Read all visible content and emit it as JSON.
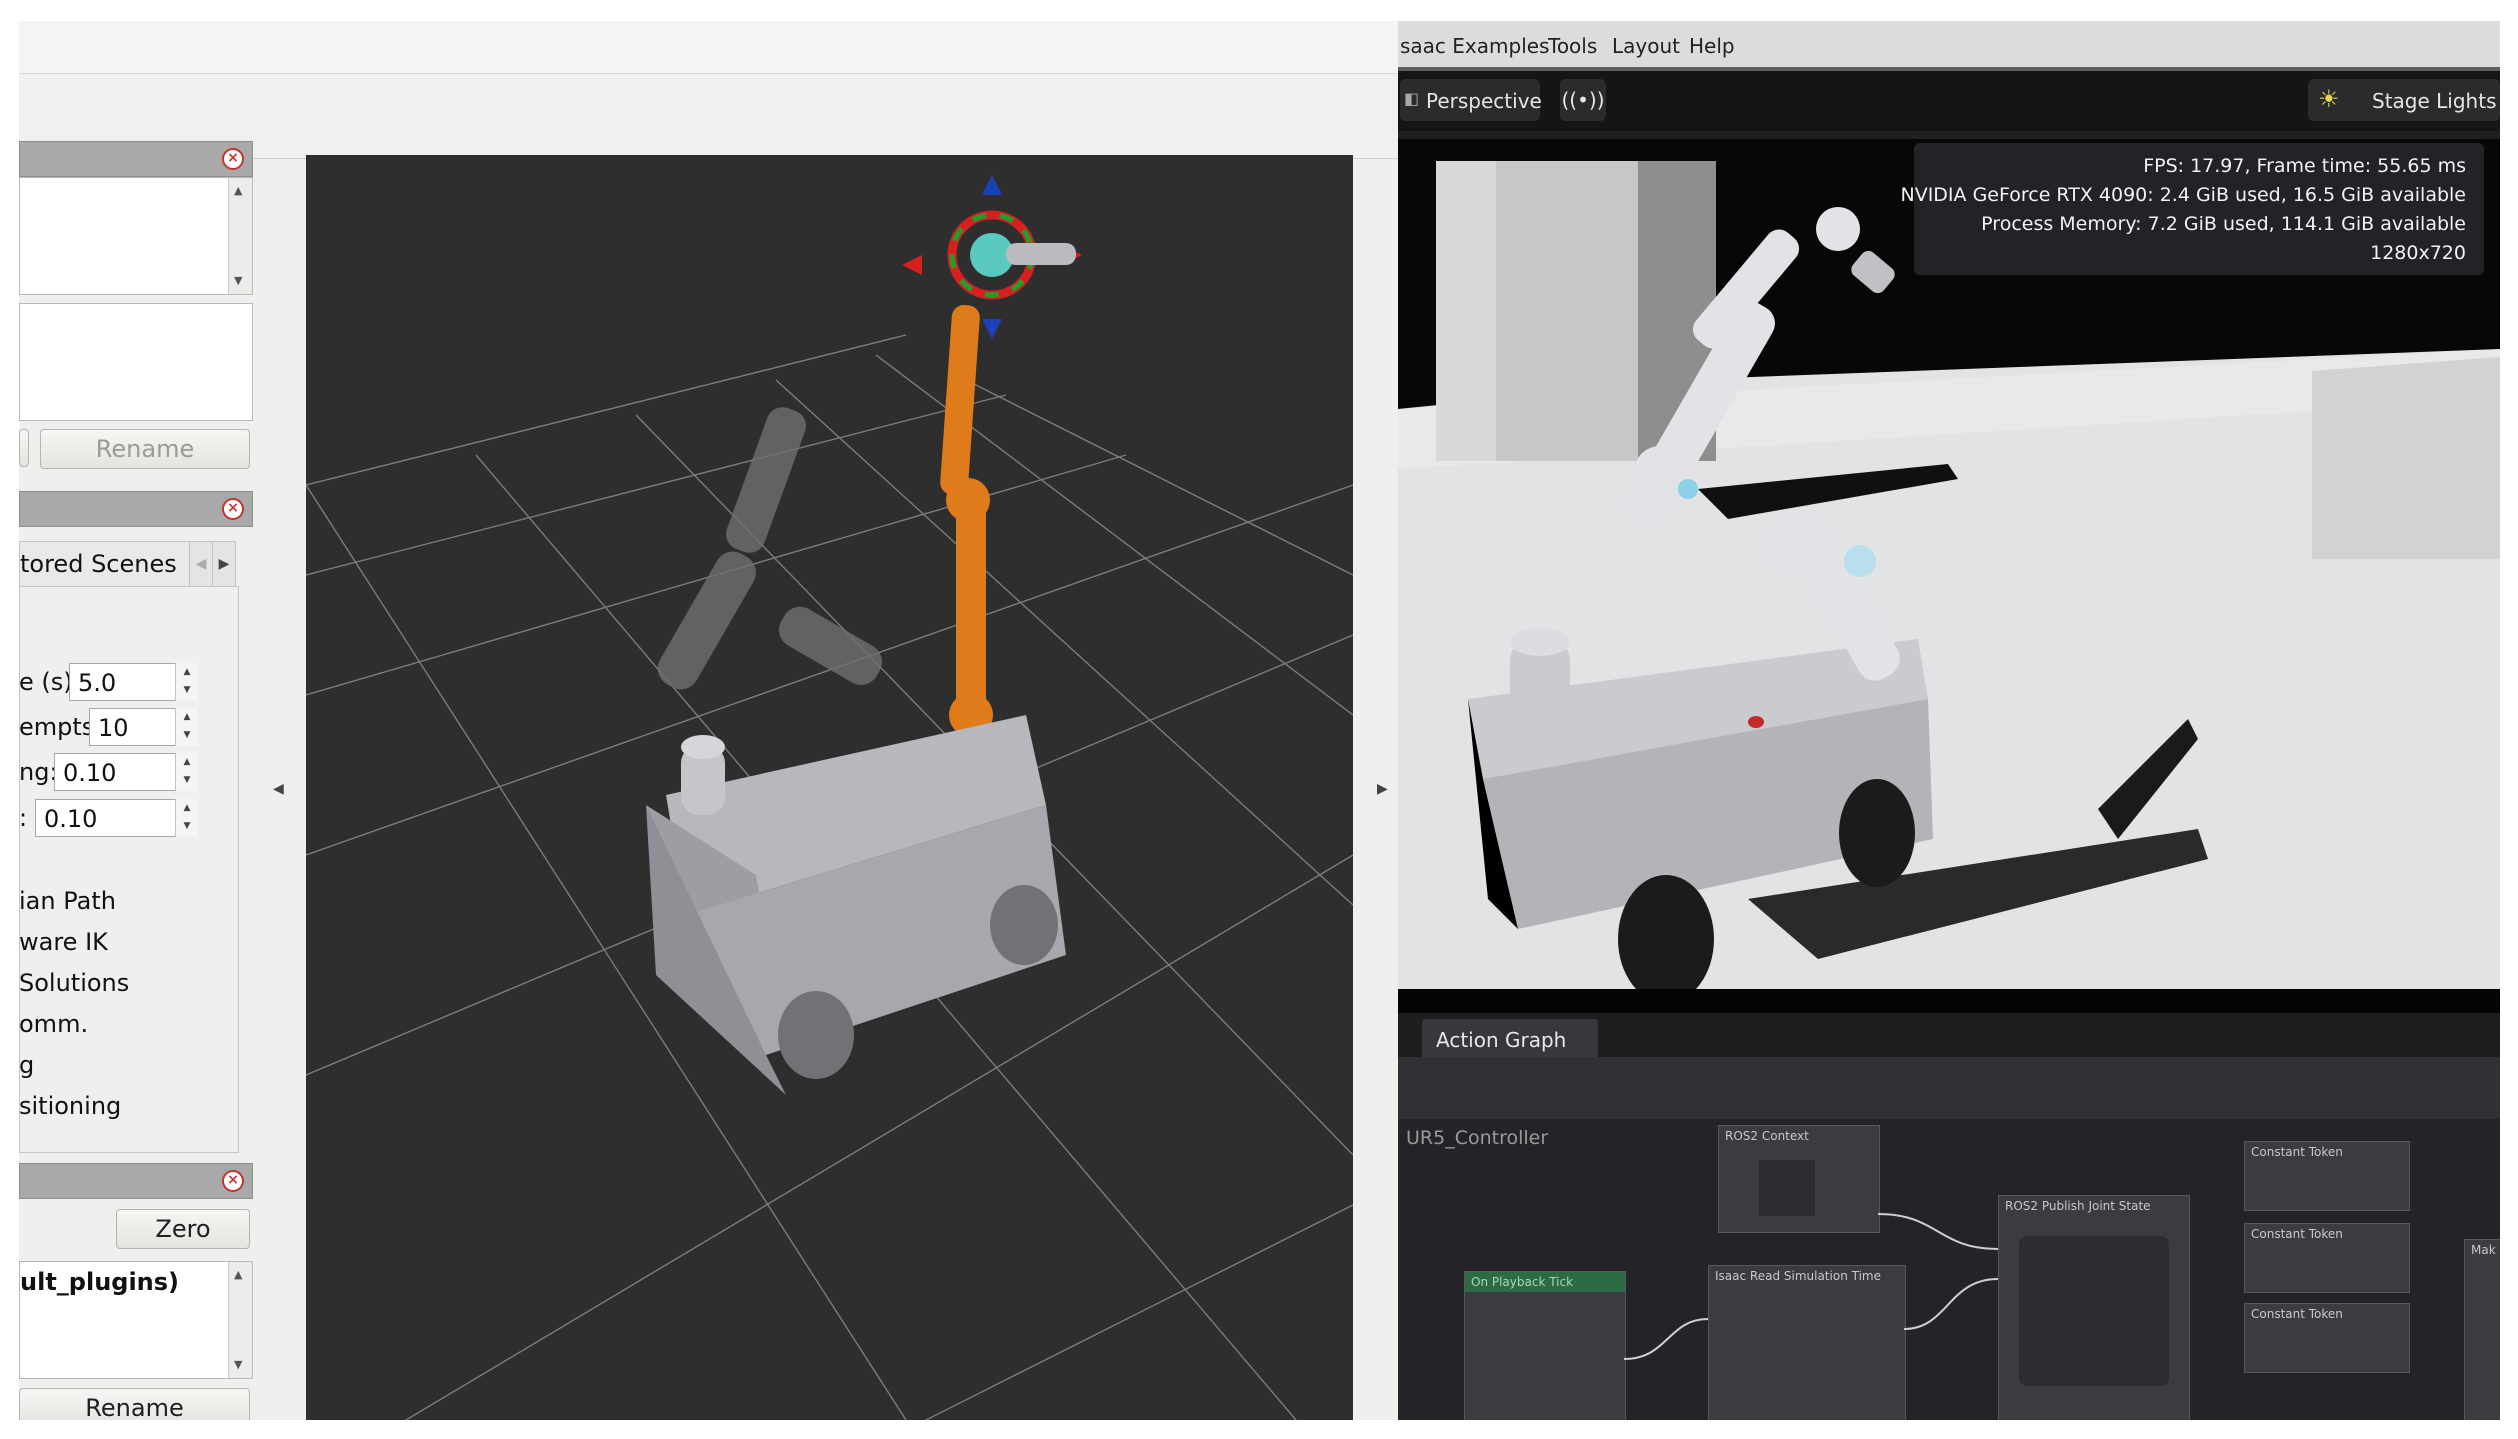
{
  "rviz": {
    "panels": {
      "scenes_panel": {
        "rename_label": "Rename"
      },
      "tabs": {
        "stored_scenes_label": "tored Scenes"
      },
      "params": [
        {
          "label": "e (s):",
          "value": "5.0"
        },
        {
          "label": "empts:",
          "value": "10"
        },
        {
          "label": "ng:",
          "value": "0.10"
        },
        {
          "label": ":",
          "value": "0.10"
        }
      ],
      "options": [
        "ian Path",
        "ware IK",
        "Solutions",
        "omm.",
        "g",
        "sitioning"
      ],
      "joints_panel": {
        "zero_label": "Zero",
        "plugins_text": "ult_plugins)",
        "rename_label": "Rename"
      }
    }
  },
  "isaac": {
    "menu": [
      "saac Examples",
      "Tools",
      "Layout",
      "Help"
    ],
    "toolbar": {
      "perspective_label": "Perspective",
      "stage_lights_label": "Stage Lights"
    },
    "stats": [
      "FPS: 17.97, Frame time: 55.65 ms",
      "NVIDIA GeForce RTX 4090: 2.4 GiB used, 16.5 GiB available",
      "Process Memory: 7.2 GiB used, 114.1 GiB available",
      "1280x720"
    ],
    "graph": {
      "tab_label": "Action Graph",
      "graph_name": "UR5_Controller",
      "nodes": {
        "ros2_context": "ROS2 Context",
        "on_playback_tick": "On Playback Tick",
        "read_sim_time": "Isaac Read Simulation Time",
        "publish_joint_state": "ROS2 Publish Joint State",
        "constant_token_1": "Constant Token",
        "constant_token_2": "Constant Token",
        "constant_token_3": "Constant Token",
        "partial_node": "Mak"
      }
    }
  }
}
